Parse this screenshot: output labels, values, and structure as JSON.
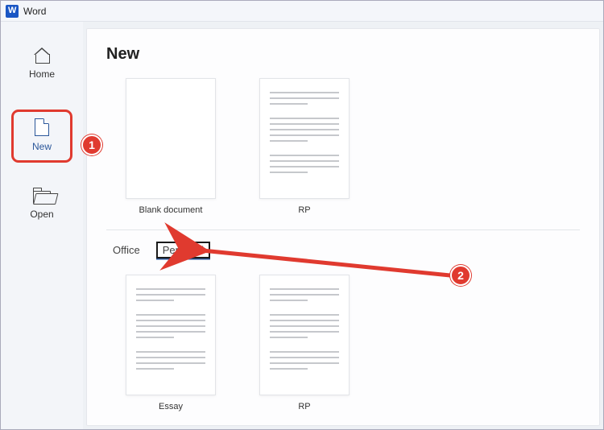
{
  "app": {
    "title": "Word"
  },
  "sidebar": {
    "items": [
      {
        "label": "Home"
      },
      {
        "label": "New"
      },
      {
        "label": "Open"
      }
    ]
  },
  "page": {
    "heading": "New",
    "top_templates": [
      {
        "label": "Blank document"
      },
      {
        "label": "RP"
      }
    ],
    "tabs": [
      {
        "label": "Office"
      },
      {
        "label": "Personal"
      }
    ],
    "bottom_templates": [
      {
        "label": "Essay"
      },
      {
        "label": "RP"
      }
    ]
  },
  "annotations": {
    "callout1": "1",
    "callout2": "2"
  }
}
